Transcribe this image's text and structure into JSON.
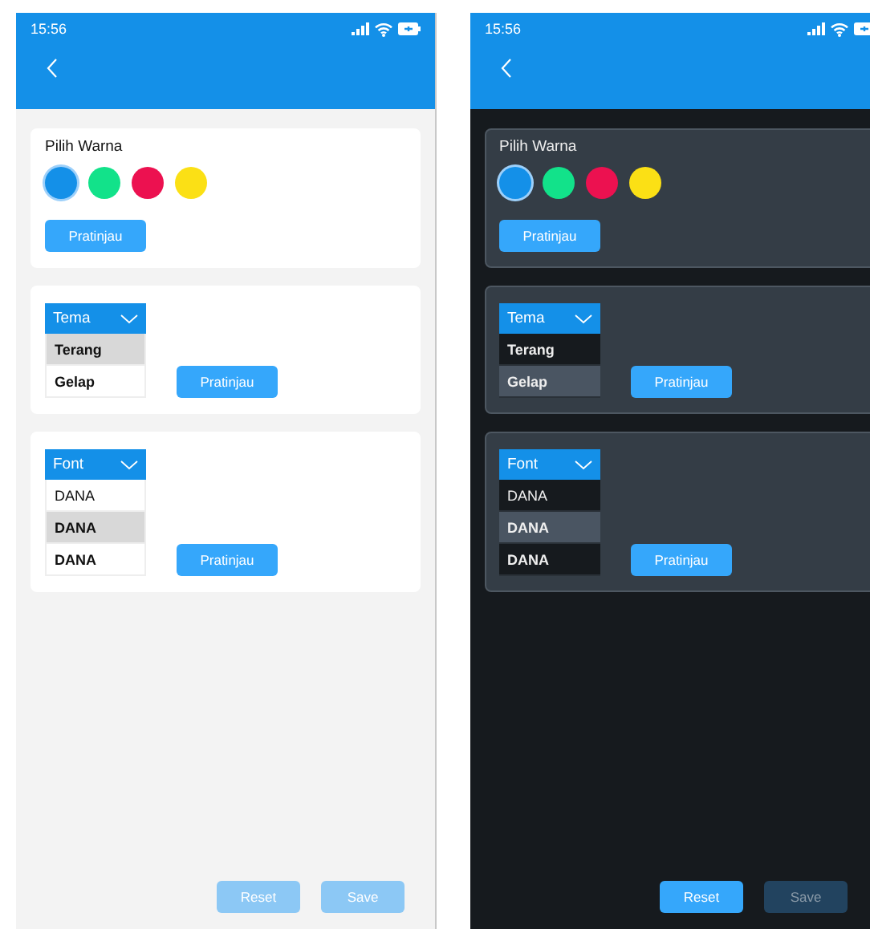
{
  "screens": [
    {
      "kind": "light",
      "time": "15:56",
      "card_title": "Pilih Warna",
      "colors": [
        {
          "color": "#1490e8",
          "selected": true
        },
        {
          "color": "#12e28a",
          "selected": false
        },
        {
          "color": "#ec1150",
          "selected": false
        },
        {
          "color": "#fbe015",
          "selected": false
        }
      ],
      "color_preview": "Pratinjau",
      "theme_dropdown": {
        "label": "Tema",
        "options": [
          {
            "label": "Terang",
            "selected": true
          },
          {
            "label": "Gelap",
            "selected": false
          }
        ]
      },
      "theme_preview": "Pratinjau",
      "font_dropdown": {
        "label": "Font",
        "options": [
          {
            "label": "DANA",
            "kind": "regular",
            "selected": false
          },
          {
            "label": "DANA",
            "kind": "bold",
            "selected": true
          },
          {
            "label": "DANA",
            "kind": "black",
            "selected": false
          }
        ]
      },
      "font_preview": "Pratinjau",
      "buttons": [
        {
          "label": "Reset",
          "disabled": true
        },
        {
          "label": "Save",
          "disabled": true
        }
      ]
    },
    {
      "kind": "dark",
      "time": "15:56",
      "card_title": "Pilih Warna",
      "colors": [
        {
          "color": "#1490e8",
          "selected": true
        },
        {
          "color": "#12e28a",
          "selected": false
        },
        {
          "color": "#ec1150",
          "selected": false
        },
        {
          "color": "#fbe015",
          "selected": false
        }
      ],
      "color_preview": "Pratinjau",
      "theme_dropdown": {
        "label": "Tema",
        "options": [
          {
            "label": "Terang",
            "selected": false
          },
          {
            "label": "Gelap",
            "selected": true
          }
        ]
      },
      "theme_preview": "Pratinjau",
      "font_dropdown": {
        "label": "Font",
        "options": [
          {
            "label": "DANA",
            "kind": "regular",
            "selected": false
          },
          {
            "label": "DANA",
            "kind": "bold",
            "selected": true
          },
          {
            "label": "DANA",
            "kind": "black",
            "selected": false
          }
        ]
      },
      "font_preview": "Pratinjau",
      "buttons": [
        {
          "label": "Reset",
          "disabled": false
        },
        {
          "label": "Save",
          "disabled": true
        }
      ]
    }
  ]
}
